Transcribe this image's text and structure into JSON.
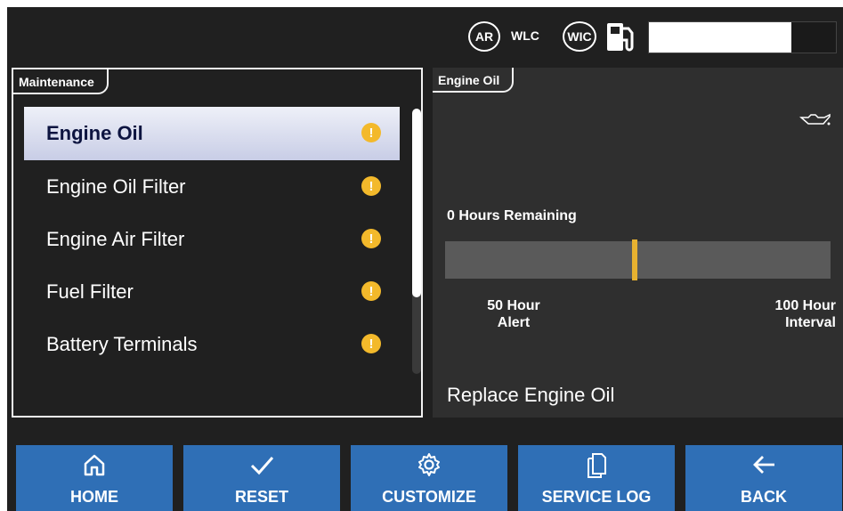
{
  "status": {
    "ar": "AR",
    "wlc": "WLC",
    "wic": "WIC",
    "fuel_level": 0.76
  },
  "maintenance": {
    "title": "Maintenance",
    "items": [
      {
        "label": "Engine Oil",
        "warn": "!"
      },
      {
        "label": "Engine Oil Filter",
        "warn": "!"
      },
      {
        "label": "Engine Air Filter",
        "warn": "!"
      },
      {
        "label": "Fuel Filter",
        "warn": "!"
      },
      {
        "label": "Battery Terminals",
        "warn": "!"
      }
    ],
    "selected_index": 0
  },
  "detail": {
    "title": "Engine Oil",
    "remaining": "0 Hours Remaining",
    "alert_line1": "50 Hour",
    "alert_line2": "Alert",
    "interval_line1": "100 Hour",
    "interval_line2": "Interval",
    "instruction": "Replace Engine Oil",
    "marker_color": "#e8b230"
  },
  "buttons": {
    "home": "HOME",
    "reset": "RESET",
    "customize": "CUSTOMIZE",
    "service_log": "SERVICE LOG",
    "back": "BACK"
  },
  "colors": {
    "button_blue": "#2f6fb6",
    "warning": "#f3b92b",
    "selected_bg": "#dfe3f2"
  }
}
